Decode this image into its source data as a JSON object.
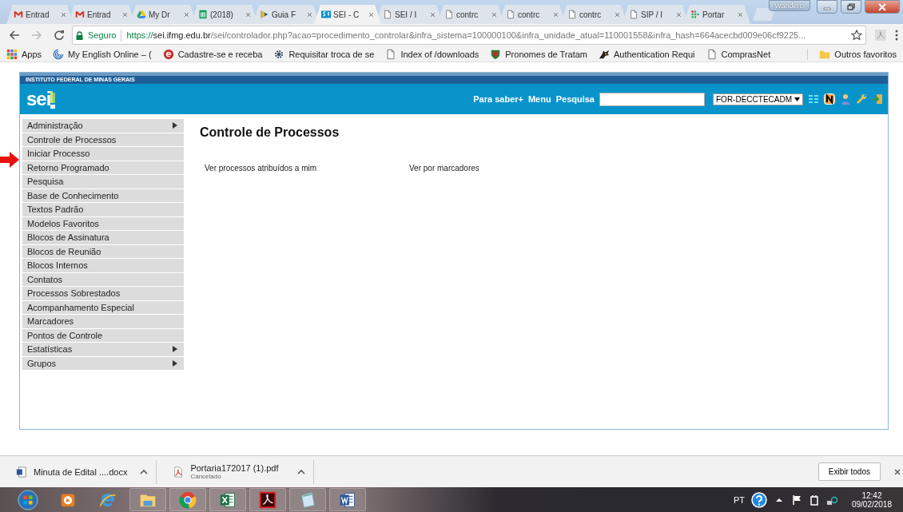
{
  "browser": {
    "tabs": [
      {
        "title": "Entrad",
        "kind": "mail",
        "selected": false
      },
      {
        "title": "Entrad",
        "kind": "mail",
        "selected": false
      },
      {
        "title": "My Dr",
        "kind": "drive",
        "selected": false
      },
      {
        "title": "(2018)",
        "kind": "sheet",
        "selected": false
      },
      {
        "title": "Guia F",
        "kind": "play",
        "selected": false
      },
      {
        "title": "SEI - C",
        "kind": "sei",
        "selected": true
      },
      {
        "title": "SEI / I",
        "kind": "page",
        "selected": false
      },
      {
        "title": "contrc",
        "kind": "page",
        "selected": false
      },
      {
        "title": "contrc",
        "kind": "page",
        "selected": false
      },
      {
        "title": "contrc",
        "kind": "page",
        "selected": false
      },
      {
        "title": "SIP / I",
        "kind": "page",
        "selected": false
      },
      {
        "title": "Portar",
        "kind": "grid",
        "selected": false
      }
    ],
    "profile": "Wanderci",
    "address": {
      "secure_label": "Seguro",
      "scheme": "https://",
      "host": "sei.ifmg.edu.br",
      "path": "/sei/controlador.php?acao=procedimento_controlar&infra_sistema=100000100&infra_unidade_atual=110001558&infra_hash=664acecbd009e06cf9225..."
    },
    "bookmarks": [
      {
        "label": "Apps",
        "kind": "apps"
      },
      {
        "label": "My English Online – (",
        "kind": "swirl"
      },
      {
        "label": "Cadastre-se e receba",
        "kind": "circle"
      },
      {
        "label": "Requisitar troca de se",
        "kind": "gear"
      },
      {
        "label": "Index of /downloads",
        "kind": "page"
      },
      {
        "label": "Pronomes de Tratam",
        "kind": "shield"
      },
      {
        "label": "Authentication Requi",
        "kind": "figure"
      },
      {
        "label": "ComprasNet",
        "kind": "page"
      }
    ],
    "other_bookmarks": "Outros favoritos"
  },
  "sei": {
    "institution": "INSTITUTO FEDERAL DE MINAS GERAIS",
    "logo": "sei",
    "header_links": [
      "Para saber+",
      "Menu",
      "Pesquisa"
    ],
    "unit": "FOR-DECCTECADM",
    "menu": [
      {
        "label": "Administração",
        "has_submenu": true
      },
      {
        "label": "Controle de Processos",
        "has_submenu": false
      },
      {
        "label": "Iniciar Processo",
        "has_submenu": false
      },
      {
        "label": "Retorno Programado",
        "has_submenu": false
      },
      {
        "label": "Pesquisa",
        "has_submenu": false
      },
      {
        "label": "Base de Conhecimento",
        "has_submenu": false
      },
      {
        "label": "Textos Padrão",
        "has_submenu": false
      },
      {
        "label": "Modelos Favoritos",
        "has_submenu": false
      },
      {
        "label": "Blocos de Assinatura",
        "has_submenu": false
      },
      {
        "label": "Blocos de Reunião",
        "has_submenu": false
      },
      {
        "label": "Blocos Internos",
        "has_submenu": false
      },
      {
        "label": "Contatos",
        "has_submenu": false
      },
      {
        "label": "Processos Sobrestados",
        "has_submenu": false
      },
      {
        "label": "Acompanhamento Especial",
        "has_submenu": false
      },
      {
        "label": "Marcadores",
        "has_submenu": false
      },
      {
        "label": "Pontos de Controle",
        "has_submenu": false
      },
      {
        "label": "Estatísticas",
        "has_submenu": true
      },
      {
        "label": "Grupos",
        "has_submenu": true
      }
    ],
    "title": "Controle de Processos",
    "links": [
      "Ver processos atribuídos a mim",
      "Ver por marcadores"
    ]
  },
  "downloads": {
    "items": [
      {
        "name": "Minuta de Edital ....docx",
        "kind": "word"
      },
      {
        "name": "Portaria172017 (1).pdf",
        "kind": "pdf",
        "status": "Cancelado"
      }
    ],
    "show_all": "Exibir todos"
  },
  "taskbar": {
    "apps": [
      {
        "kind": "start"
      },
      {
        "kind": "media"
      },
      {
        "kind": "ie"
      },
      {
        "kind": "folder"
      },
      {
        "kind": "chrome"
      },
      {
        "kind": "excel"
      },
      {
        "kind": "acrobat"
      },
      {
        "kind": "notepad"
      },
      {
        "kind": "word"
      }
    ],
    "language": "PT",
    "time": "12:42",
    "date": "09/02/2018"
  }
}
